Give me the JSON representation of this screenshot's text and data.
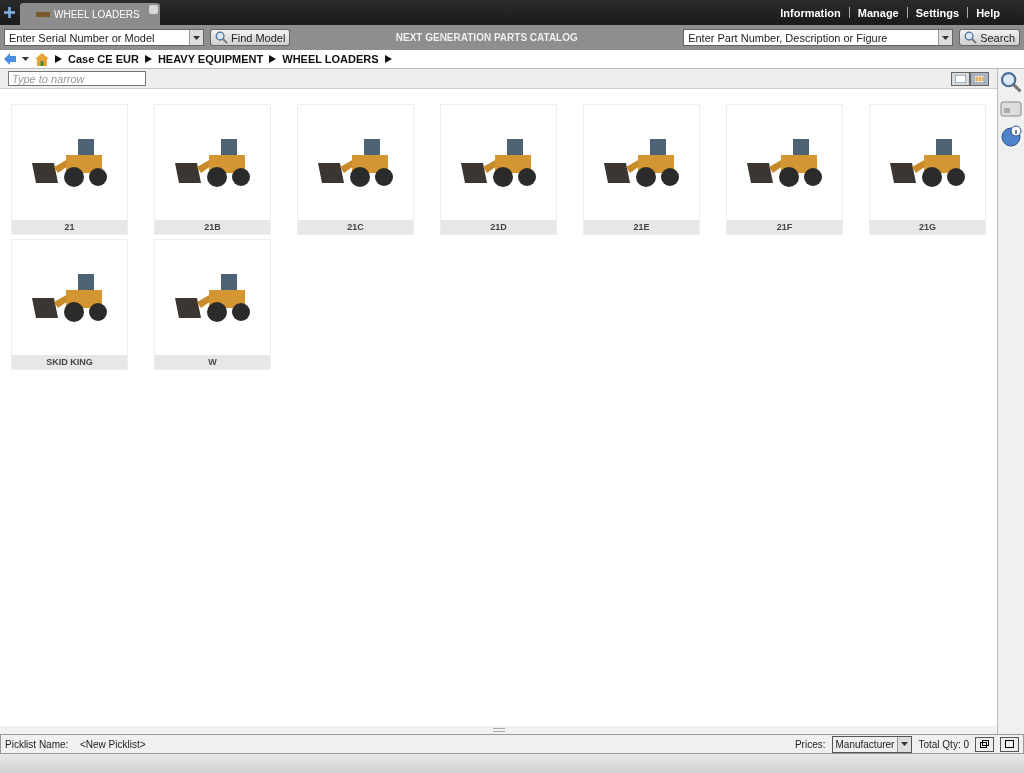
{
  "tab": {
    "label": "WHEEL LOADERS"
  },
  "top_menu": [
    "Information",
    "Manage",
    "Settings",
    "Help"
  ],
  "toolbar": {
    "serial_field": {
      "value": "Enter Serial Number or Model"
    },
    "find_button": "Find Model",
    "title": "NEXT GENERATION PARTS CATALOG",
    "part_field": {
      "value": "Enter Part Number, Description or Figure"
    },
    "search_button": "Search"
  },
  "breadcrumb": [
    "Case CE EUR",
    "HEAVY EQUIPMENT",
    "WHEEL LOADERS"
  ],
  "filter": {
    "placeholder": "Type to narrow"
  },
  "view_toggle": [
    {
      "kind": "list",
      "selected": false
    },
    {
      "kind": "grid",
      "selected": true
    }
  ],
  "models": [
    {
      "label": "21"
    },
    {
      "label": "21B"
    },
    {
      "label": "21C"
    },
    {
      "label": "21D"
    },
    {
      "label": "21E"
    },
    {
      "label": "21F"
    },
    {
      "label": "21G"
    },
    {
      "label": "SKID KING"
    },
    {
      "label": "W"
    }
  ],
  "status_bar": {
    "picklist_label": "Picklist Name:",
    "picklist_value": "<New Picklist>",
    "prices_label": "Prices:",
    "prices_value": "Manufacturer",
    "total": "Total Qty: 0"
  }
}
